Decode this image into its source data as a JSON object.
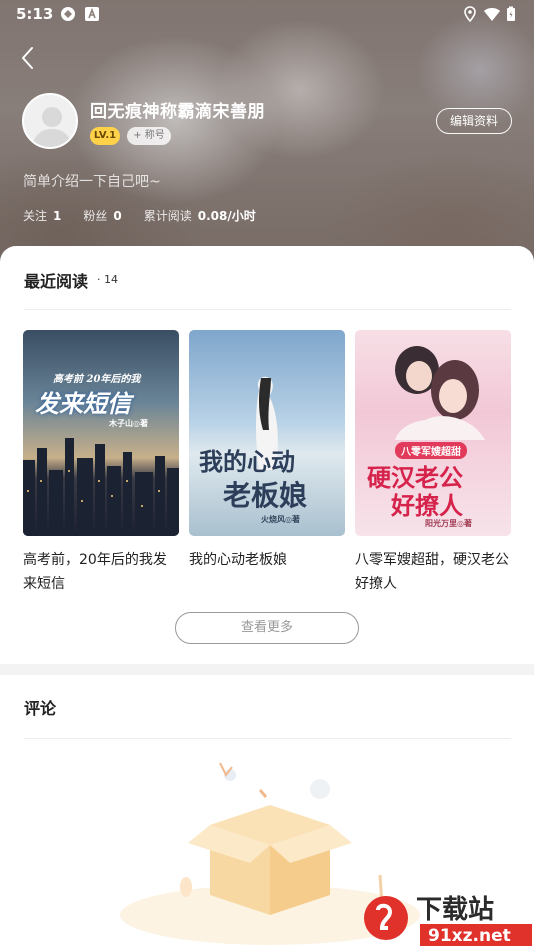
{
  "status_bar": {
    "time": "5:13",
    "icons": [
      "vpn-key-icon",
      "a-icon",
      "location-icon",
      "wifi-icon",
      "battery-icon"
    ]
  },
  "header": {
    "back_icon": "chevron-left-icon",
    "username": "回无痕神称霸滴宋善朋",
    "level": "LV.1",
    "title_badge": "+ 称号",
    "edit_button": "编辑资料",
    "bio": "简单介绍一下自己吧~",
    "stats": [
      {
        "label": "关注",
        "value": "1"
      },
      {
        "label": "粉丝",
        "value": "0"
      },
      {
        "label": "累计阅读",
        "value": "0.08/小时"
      }
    ]
  },
  "recent": {
    "title": "最近阅读",
    "count": "· 14",
    "books": [
      {
        "title": "高考前，20年后的我发来短信",
        "cover_top": "高考前 20年后的我",
        "cover_main": "发来短信",
        "cover_author": "木子山◎著"
      },
      {
        "title": "我的心动老板娘",
        "cover_main_1": "我的心动",
        "cover_main_2": "老板娘",
        "cover_author": "火烧风◎著"
      },
      {
        "title": "八零军嫂超甜，硬汉老公好撩人",
        "cover_top": "八零军嫂超甜",
        "cover_main_1": "硬汉老公",
        "cover_main_2": "好撩人",
        "cover_author": "阳光万里◎著"
      }
    ],
    "more_button": "查看更多"
  },
  "comments": {
    "title": "评论"
  },
  "watermark": {
    "brand": "下载站",
    "url": "91xz.net"
  },
  "colors": {
    "level_badge": "#ffd24a",
    "watermark_red": "#e0312b"
  }
}
